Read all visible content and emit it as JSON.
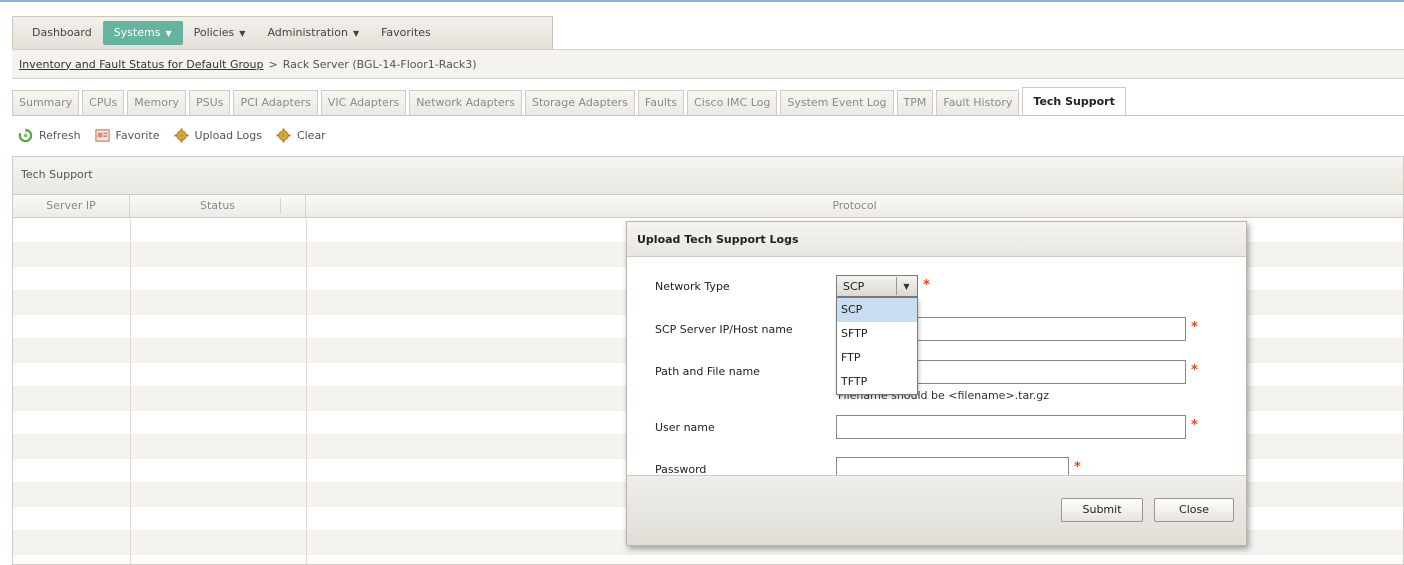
{
  "menu": {
    "items": [
      {
        "label": "Dashboard",
        "caret": ""
      },
      {
        "label": "Systems",
        "caret": "▼"
      },
      {
        "label": "Policies",
        "caret": "▼"
      },
      {
        "label": "Administration",
        "caret": "▼"
      },
      {
        "label": "Favorites",
        "caret": ""
      }
    ],
    "active_color": "#66b3a0"
  },
  "breadcrumb": {
    "link": "Inventory and Fault Status for Default Group",
    "separator": ">",
    "current": "Rack Server (BGL-14-Floor1-Rack3)"
  },
  "tabs": [
    "Summary",
    "CPUs",
    "Memory",
    "PSUs",
    "PCI Adapters",
    "VIC Adapters",
    "Network Adapters",
    "Storage Adapters",
    "Faults",
    "Cisco IMC Log",
    "System Event Log",
    "TPM",
    "Fault History",
    "Tech Support"
  ],
  "active_tab": "Tech Support",
  "toolbar": {
    "refresh": "Refresh",
    "favorite": "Favorite",
    "upload_logs": "Upload Logs",
    "clear": "Clear"
  },
  "panel": {
    "title": "Tech Support",
    "columns": [
      "Server IP",
      "Status",
      "Protocol"
    ]
  },
  "modal": {
    "title": "Upload Tech Support Logs",
    "network_type_label": "Network Type",
    "network_type_value": "SCP",
    "network_type_options": [
      "SCP",
      "SFTP",
      "FTP",
      "TFTP"
    ],
    "server_label": "SCP Server IP/Host name",
    "path_label": "Path and File name",
    "path_hint": "Filename should be <filename>.tar.gz",
    "user_label": "User name",
    "password_label": "Password",
    "required_mark": "*",
    "submit": "Submit",
    "close": "Close"
  },
  "icons": {
    "refresh": "refresh-icon",
    "favorite": "favorite-icon",
    "upload_logs": "gear-icon",
    "clear": "gear-icon"
  }
}
